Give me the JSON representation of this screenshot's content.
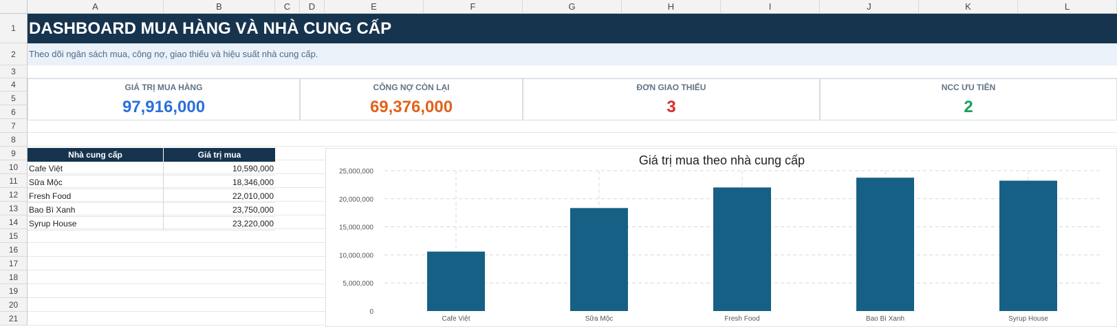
{
  "columns": [
    "A",
    "B",
    "C",
    "D",
    "E",
    "F",
    "G",
    "H",
    "I",
    "J",
    "K",
    "L"
  ],
  "rows": [
    "1",
    "2",
    "3",
    "4",
    "5",
    "6",
    "7",
    "8",
    "9",
    "10",
    "11",
    "12",
    "13",
    "14",
    "15",
    "16",
    "17",
    "18",
    "19",
    "20",
    "21"
  ],
  "dashboard": {
    "title": "DASHBOARD MUA HÀNG VÀ NHÀ CUNG CẤP",
    "subtitle": "Theo dõi ngân sách mua, công nợ, giao thiếu và hiệu suất nhà cung cấp."
  },
  "kpis": [
    {
      "label": "GIÁ TRỊ MUA HÀNG",
      "value": "97,916,000",
      "color": "#2b6fdc"
    },
    {
      "label": "CÔNG NỢ CÒN LẠI",
      "value": "69,376,000",
      "color": "#e2621b"
    },
    {
      "label": "ĐƠN GIAO THIẾU",
      "value": "3",
      "color": "#d92b2b"
    },
    {
      "label": "NCC ƯU TIÊN",
      "value": "2",
      "color": "#16a05a"
    }
  ],
  "supplier_table": {
    "headers": [
      "Nhà cung cấp",
      "Giá trị mua"
    ],
    "rows": [
      {
        "name": "Cafe Việt",
        "value": "10,590,000"
      },
      {
        "name": "Sữa Mộc",
        "value": "18,346,000"
      },
      {
        "name": "Fresh Food",
        "value": "22,010,000"
      },
      {
        "name": "Bao Bì Xanh",
        "value": "23,750,000"
      },
      {
        "name": "Syrup House",
        "value": "23,220,000"
      }
    ]
  },
  "chart_data": {
    "type": "bar",
    "title": "Giá trị mua theo nhà cung cấp",
    "categories": [
      "Cafe Việt",
      "Sữa Mộc",
      "Fresh Food",
      "Bao Bì Xanh",
      "Syrup House"
    ],
    "values": [
      10590000,
      18346000,
      22010000,
      23750000,
      23220000
    ],
    "ylim": [
      0,
      25000000
    ],
    "yticks": [
      "0",
      "5,000,000",
      "10,000,000",
      "15,000,000",
      "20,000,000",
      "25,000,000"
    ],
    "grid": true,
    "bar_color": "#176085"
  }
}
